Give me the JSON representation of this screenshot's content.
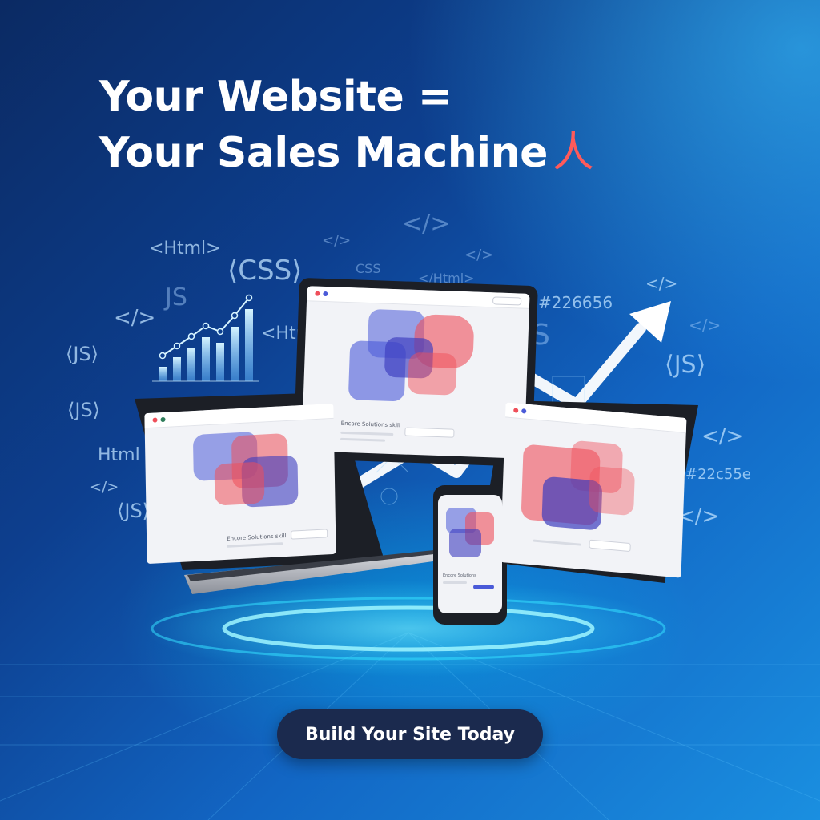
{
  "headline": {
    "line1": "Your Website =",
    "line2": "Your Sales Machine",
    "accent_glyph": "人"
  },
  "code_tokens": [
    "<Html>",
    "⟨CSS⟩",
    "CSS",
    "</>",
    "</>",
    "</>",
    "</>",
    "</>",
    "JS",
    "⟨JS⟩",
    "⟨JS⟩",
    "⟨JS⟩",
    "⟨JS⟩",
    "Html",
    "<Html",
    "</>",
    "#226656",
    "#22c55e",
    "</>",
    "</>",
    "</>",
    "S",
    "</Html>"
  ],
  "screens": {
    "tablet_caption": "Encore Solutions skill",
    "laptop_caption": "Encore Solutions skill",
    "phone_caption": "Encore Solutions"
  },
  "cta": {
    "label": "Build Your Site Today"
  },
  "colors": {
    "background_dark": "#0b2a63",
    "background_light": "#1a8fe0",
    "accent_red": "#ff5a5a",
    "blob_blue": "#4a5ad8",
    "blob_red": "#ef4f5a",
    "button_bg": "#1b2a4e",
    "glow": "#35e0ff"
  },
  "chart_bars": [
    0.18,
    0.3,
    0.42,
    0.55,
    0.48,
    0.68,
    0.9
  ],
  "icons": [
    "trend-arrow-icon",
    "bar-chart-icon",
    "code-tag-icon"
  ]
}
